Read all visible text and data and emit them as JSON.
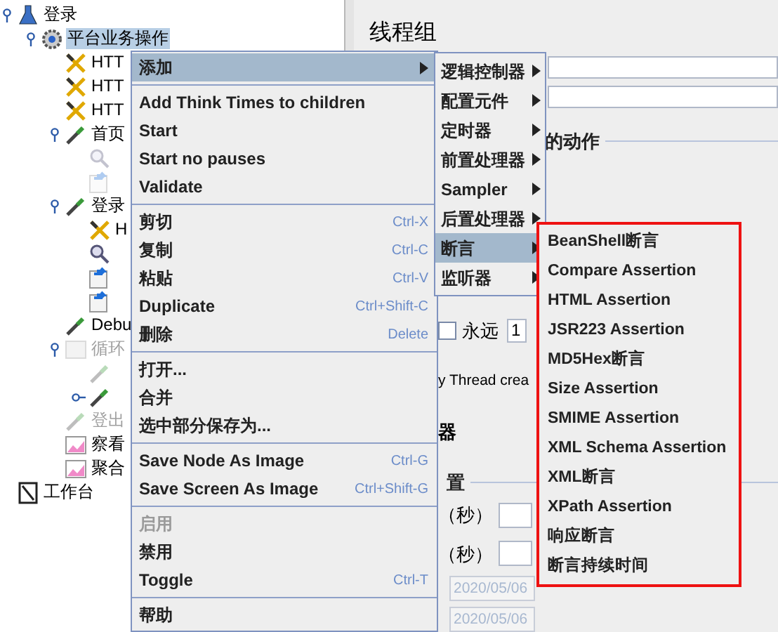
{
  "tree": [
    {
      "label": "登录",
      "kind": "test_plan",
      "expanded": true,
      "selected": false,
      "disabled": false,
      "children": [
        {
          "label": "平台业务操作",
          "kind": "thread_group",
          "expanded": true,
          "selected": true,
          "disabled": false,
          "children": [
            {
              "label": "HTT",
              "kind": "sampler",
              "selected": false,
              "disabled": false
            },
            {
              "label": "HTT",
              "kind": "sampler",
              "selected": false,
              "disabled": false
            },
            {
              "label": "HTT",
              "kind": "sampler",
              "selected": false,
              "disabled": false
            },
            {
              "label": "首页",
              "kind": "controller",
              "expanded": true,
              "selected": false,
              "disabled": false,
              "children": [
                {
                  "kind": "extractor",
                  "disabled": true
                },
                {
                  "kind": "processor",
                  "disabled": true
                }
              ]
            },
            {
              "label": "登录",
              "kind": "controller",
              "expanded": true,
              "selected": false,
              "disabled": false,
              "children": [
                {
                  "label": "H",
                  "kind": "sampler",
                  "selected": false,
                  "disabled": false
                },
                {
                  "kind": "extractor",
                  "disabled": false
                },
                {
                  "kind": "processor",
                  "disabled": false
                },
                {
                  "kind": "processor",
                  "disabled": false
                }
              ]
            },
            {
              "label": "Debu",
              "kind": "controller",
              "selected": false,
              "disabled": false
            },
            {
              "label": "循环",
              "kind": "loop",
              "expanded": true,
              "selected": false,
              "disabled": true,
              "children": [
                {
                  "kind": "controller",
                  "disabled": true
                },
                {
                  "kind": "controller",
                  "expanded": false,
                  "disabled": false
                }
              ]
            },
            {
              "label": "登出",
              "kind": "controller",
              "selected": false,
              "disabled": true
            },
            {
              "label": "察看",
              "kind": "listener",
              "selected": false,
              "disabled": false
            },
            {
              "label": "聚合",
              "kind": "listener",
              "selected": false,
              "disabled": false
            }
          ]
        }
      ]
    },
    {
      "label": "工作台",
      "kind": "workbench",
      "selected": false,
      "disabled": false
    }
  ],
  "panel": {
    "title": "线程组",
    "group_title": "的动作",
    "forever": {
      "label": "永远",
      "checked": false
    },
    "loop_value": "1",
    "thread_text": "y Thread crea",
    "label_1": "器",
    "group_title_2": "置",
    "seconds_1": "（秒）",
    "seconds_2": "（秒）",
    "date_1": "2020/05/06",
    "date_2": "2020/05/06"
  },
  "context_menu": [
    {
      "kind": "item",
      "label": "添加",
      "submenu": true,
      "selected": true,
      "disabled": false
    },
    {
      "kind": "separator"
    },
    {
      "kind": "item",
      "label": "Add Think Times to children",
      "selected": false,
      "disabled": false
    },
    {
      "kind": "item",
      "label": "Start",
      "selected": false,
      "disabled": false
    },
    {
      "kind": "item",
      "label": "Start no pauses",
      "selected": false,
      "disabled": false
    },
    {
      "kind": "item",
      "label": "Validate",
      "selected": false,
      "disabled": false
    },
    {
      "kind": "separator"
    },
    {
      "kind": "item",
      "label": "剪切",
      "shortcut": "Ctrl-X",
      "selected": false,
      "disabled": false
    },
    {
      "kind": "item",
      "label": "复制",
      "shortcut": "Ctrl-C",
      "selected": false,
      "disabled": false
    },
    {
      "kind": "item",
      "label": "粘贴",
      "shortcut": "Ctrl-V",
      "selected": false,
      "disabled": false
    },
    {
      "kind": "item",
      "label": "Duplicate",
      "shortcut": "Ctrl+Shift-C",
      "selected": false,
      "disabled": false
    },
    {
      "kind": "item",
      "label": "删除",
      "shortcut": "Delete",
      "selected": false,
      "disabled": false
    },
    {
      "kind": "separator"
    },
    {
      "kind": "item",
      "label": "打开...",
      "selected": false,
      "disabled": false
    },
    {
      "kind": "item",
      "label": "合并",
      "selected": false,
      "disabled": false
    },
    {
      "kind": "item",
      "label": "选中部分保存为...",
      "selected": false,
      "disabled": false
    },
    {
      "kind": "separator"
    },
    {
      "kind": "item",
      "label": "Save Node As Image",
      "shortcut": "Ctrl-G",
      "selected": false,
      "disabled": false
    },
    {
      "kind": "item",
      "label": "Save Screen As Image",
      "shortcut": "Ctrl+Shift-G",
      "selected": false,
      "disabled": false
    },
    {
      "kind": "separator"
    },
    {
      "kind": "item",
      "label": "启用",
      "selected": false,
      "disabled": true
    },
    {
      "kind": "item",
      "label": "禁用",
      "selected": false,
      "disabled": false
    },
    {
      "kind": "item",
      "label": "Toggle",
      "shortcut": "Ctrl-T",
      "selected": false,
      "disabled": false
    },
    {
      "kind": "separator"
    },
    {
      "kind": "item",
      "label": "帮助",
      "selected": false,
      "disabled": false
    }
  ],
  "add_submenu": [
    {
      "label": "逻辑控制器",
      "submenu": true,
      "selected": false
    },
    {
      "label": "配置元件",
      "submenu": true,
      "selected": false
    },
    {
      "label": "定时器",
      "submenu": true,
      "selected": false
    },
    {
      "label": "前置处理器",
      "submenu": true,
      "selected": false
    },
    {
      "label": "Sampler",
      "submenu": true,
      "selected": false
    },
    {
      "label": "后置处理器",
      "submenu": true,
      "selected": false
    },
    {
      "label": "断言",
      "submenu": true,
      "selected": true
    },
    {
      "label": "监听器",
      "submenu": true,
      "selected": false
    }
  ],
  "assertion_submenu": {
    "highlighted": true,
    "items": [
      {
        "label": "BeanShell断言"
      },
      {
        "label": "Compare Assertion"
      },
      {
        "label": "HTML Assertion"
      },
      {
        "label": "JSR223 Assertion"
      },
      {
        "label": "MD5Hex断言"
      },
      {
        "label": "Size Assertion"
      },
      {
        "label": "SMIME Assertion"
      },
      {
        "label": "XML Schema Assertion"
      },
      {
        "label": "XML断言"
      },
      {
        "label": "XPath Assertion"
      },
      {
        "label": "响应断言"
      },
      {
        "label": "断言持续时间"
      }
    ]
  }
}
